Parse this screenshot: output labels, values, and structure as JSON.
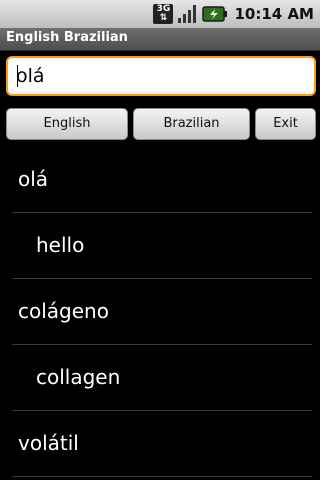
{
  "status_bar": {
    "network": "3G",
    "time": "10:14 AM",
    "icons": [
      "3g-icon",
      "signal-icon",
      "battery-icon"
    ]
  },
  "app": {
    "title": "English Brazilian"
  },
  "search": {
    "value": "olá",
    "placeholder": ""
  },
  "buttons": {
    "english": "English",
    "brazilian": "Brazilian",
    "exit": "Exit"
  },
  "results": [
    {
      "text": "olá",
      "level": 0
    },
    {
      "text": "hello",
      "level": 1
    },
    {
      "text": "colágeno",
      "level": 0
    },
    {
      "text": "collagen",
      "level": 1
    },
    {
      "text": "volátil",
      "level": 0
    }
  ],
  "colors": {
    "accent": "#ff9a1a",
    "background": "#000000",
    "divider": "#3a3a3a"
  }
}
